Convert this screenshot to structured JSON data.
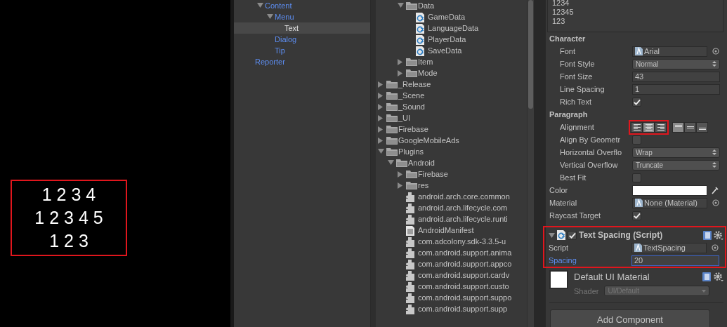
{
  "game_view": {
    "annotated": true,
    "lines": [
      "1 2 3 4",
      "1 2 3 4 5",
      "1 2 3"
    ]
  },
  "hierarchy": {
    "continued_items": [
      {
        "label": "Content",
        "expanded": true,
        "selected": false,
        "children": [
          {
            "label": "Menu",
            "expanded": true,
            "selected": false,
            "children": [
              {
                "label": "Text",
                "selected": true
              }
            ]
          },
          {
            "label": "Dialog",
            "selected": false
          },
          {
            "label": "Tip",
            "selected": false
          }
        ]
      }
    ],
    "items": [
      {
        "label": "Reporter",
        "selected": false
      }
    ]
  },
  "project": {
    "continued_items": [
      {
        "kind": "folder",
        "label": "Data",
        "expanded": true,
        "children": [
          {
            "kind": "script",
            "label": "GameData"
          },
          {
            "kind": "script",
            "label": "LanguageData"
          },
          {
            "kind": "script",
            "label": "PlayerData"
          },
          {
            "kind": "script",
            "label": "SaveData"
          }
        ]
      },
      {
        "kind": "folder",
        "label": "Item",
        "expanded": false
      },
      {
        "kind": "folder",
        "label": "Mode",
        "expanded": false
      }
    ],
    "items": [
      {
        "kind": "folder",
        "label": "_Release",
        "expanded": false
      },
      {
        "kind": "folder",
        "label": "_Scene",
        "expanded": false
      },
      {
        "kind": "folder",
        "label": "_Sound",
        "expanded": false
      },
      {
        "kind": "folder",
        "label": "_UI",
        "expanded": false
      },
      {
        "kind": "folder",
        "label": "Firebase",
        "expanded": false
      },
      {
        "kind": "folder",
        "label": "GoogleMobileAds",
        "expanded": false
      },
      {
        "kind": "folder",
        "label": "Plugins",
        "expanded": true,
        "children": [
          {
            "kind": "folder",
            "label": "Android",
            "expanded": true,
            "children": [
              {
                "kind": "folder",
                "label": "Firebase",
                "expanded": false
              },
              {
                "kind": "folder",
                "label": "res",
                "expanded": false
              },
              {
                "kind": "plugin",
                "label": "android.arch.core.common"
              },
              {
                "kind": "plugin",
                "label": "android.arch.lifecycle.com"
              },
              {
                "kind": "plugin",
                "label": "android.arch.lifecycle.runti"
              },
              {
                "kind": "manifest",
                "label": "AndroidManifest"
              },
              {
                "kind": "plugin",
                "label": "com.adcolony.sdk-3.3.5-u"
              },
              {
                "kind": "plugin",
                "label": "com.android.support.anima"
              },
              {
                "kind": "plugin",
                "label": "com.android.support.appco"
              },
              {
                "kind": "plugin",
                "label": "com.android.support.cardv"
              },
              {
                "kind": "plugin",
                "label": "com.android.support.custo"
              },
              {
                "kind": "plugin",
                "label": "com.android.support.suppo"
              },
              {
                "kind": "plugin",
                "label": "com.android.support.supp"
              }
            ]
          }
        ]
      }
    ]
  },
  "inspector": {
    "text_lines": [
      "1234",
      "12345",
      "123"
    ],
    "rows": [
      {
        "kind": "heading",
        "label": "Character",
        "children": [
          {
            "kind": "object",
            "label": "Font",
            "value": "Arial"
          },
          {
            "kind": "dropdown",
            "label": "Font Style",
            "value": "Normal"
          },
          {
            "kind": "text",
            "label": "Font Size",
            "value": "43",
            "focused": false
          },
          {
            "kind": "text",
            "label": "Line Spacing",
            "value": "1",
            "focused": false
          },
          {
            "kind": "checkbox",
            "label": "Rich Text",
            "checked": true
          }
        ]
      },
      {
        "kind": "heading",
        "label": "Paragraph",
        "children": [
          {
            "kind": "alignment",
            "label": "Alignment",
            "annotated": true,
            "horizontal": [
              {
                "selected": false
              },
              {
                "selected": true
              },
              {
                "selected": false
              }
            ],
            "vertical": [
              {
                "selected": true
              },
              {
                "selected": false
              },
              {
                "selected": false
              }
            ]
          },
          {
            "kind": "checkbox",
            "label": "Align By Geometr",
            "checked": false
          },
          {
            "kind": "dropdown",
            "label": "Horizontal Overflo",
            "value": "Wrap"
          },
          {
            "kind": "dropdown",
            "label": "Vertical Overflow",
            "value": "Truncate"
          },
          {
            "kind": "checkbox",
            "label": "Best Fit",
            "checked": false
          }
        ]
      },
      {
        "kind": "color",
        "label": "Color",
        "color": "#ffffff"
      },
      {
        "kind": "object",
        "label": "Material",
        "value": "None (Material)"
      },
      {
        "kind": "checkbox",
        "label": "Raycast Target",
        "checked": true
      }
    ],
    "component": {
      "title": "Text Spacing (Script)",
      "enabled": true,
      "expanded": true,
      "annotated": true,
      "rows": [
        {
          "kind": "object",
          "label": "Script",
          "value": "TextSpacing"
        },
        {
          "kind": "text",
          "label": "Spacing",
          "value": "20",
          "focused": true
        }
      ]
    },
    "material": {
      "name": "Default UI Material",
      "shader_label": "Shader",
      "shader": "UI/Default"
    },
    "add_component": "Add Component"
  }
}
